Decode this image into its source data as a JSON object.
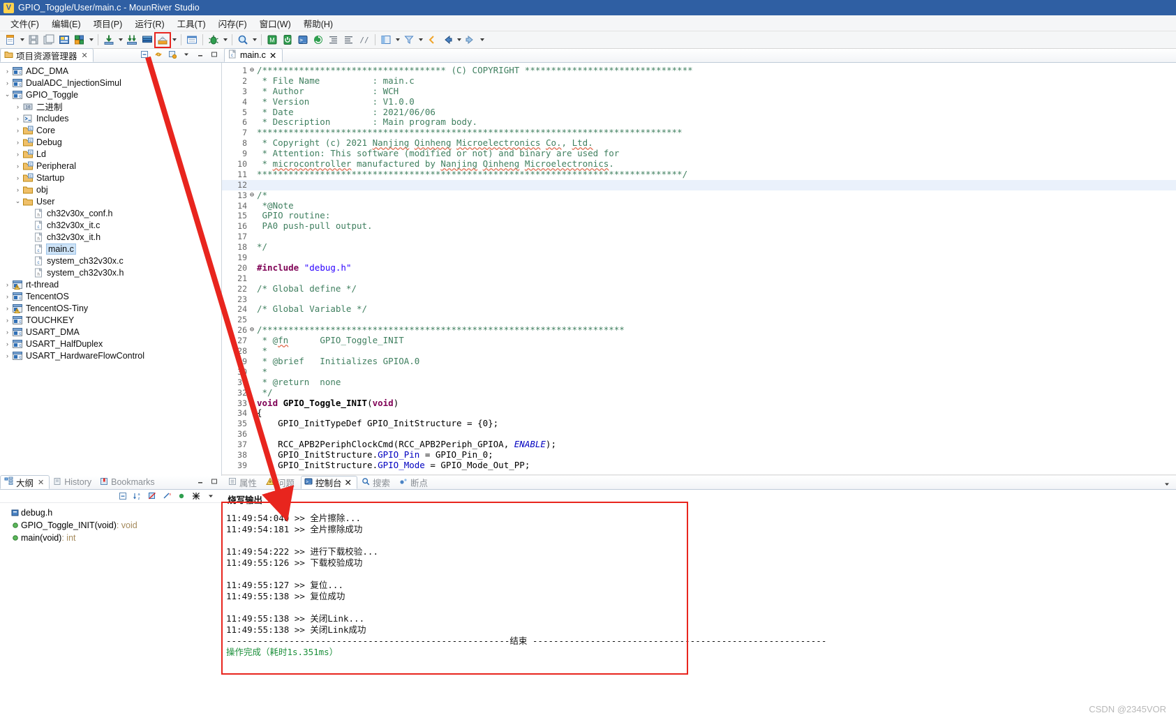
{
  "window": {
    "title": "GPIO_Toggle/User/main.c - MounRiver Studio",
    "app_icon": "mounriver-logo-icon"
  },
  "menubar": {
    "items": [
      {
        "label": "文件(F)",
        "name": "menu-file"
      },
      {
        "label": "编辑(E)",
        "name": "menu-edit"
      },
      {
        "label": "项目(P)",
        "name": "menu-project"
      },
      {
        "label": "运行(R)",
        "name": "menu-run"
      },
      {
        "label": "工具(T)",
        "name": "menu-tools"
      },
      {
        "label": "闪存(F)",
        "name": "menu-flash"
      },
      {
        "label": "窗口(W)",
        "name": "menu-window"
      },
      {
        "label": "帮助(H)",
        "name": "menu-help"
      }
    ]
  },
  "toolbar": {
    "highlighted_button": "download-flash-button",
    "buttons": [
      "new-file-icon",
      "save-icon",
      "save-all-icon",
      "build-project-icon",
      "build-config-icon",
      "download-icon",
      "download-all-icon",
      "library-icon",
      "download-flash-icon",
      "terminal-icon",
      "debug-icon",
      "search-icon",
      "excel-icon",
      "power-icon",
      "console-icon",
      "refresh-icon",
      "indent-left-icon",
      "indent-right-icon",
      "comment-icon",
      "perspective-icon",
      "filter-icon",
      "back-small-icon",
      "back-icon",
      "forward-icon"
    ]
  },
  "project_explorer": {
    "tab_label": "项目资源管理器",
    "tab_close": "✕",
    "tools": [
      "collapse-all-icon",
      "link-with-editor-icon",
      "view-menu-icon",
      "minimize-icon",
      "maximize-icon"
    ],
    "tree": [
      {
        "label": "ADC_DMA",
        "depth": 0,
        "arrow": "›",
        "icon": "c-project-icon",
        "selected": false
      },
      {
        "label": "DualADC_InjectionSimul",
        "depth": 0,
        "arrow": "›",
        "icon": "c-project-icon",
        "selected": false
      },
      {
        "label": "GPIO_Toggle",
        "depth": 0,
        "arrow": "⌄",
        "icon": "c-project-icon",
        "selected": false
      },
      {
        "label": "二进制",
        "depth": 1,
        "arrow": "›",
        "icon": "binaries-icon",
        "selected": false
      },
      {
        "label": "Includes",
        "depth": 1,
        "arrow": "›",
        "icon": "includes-icon",
        "selected": false
      },
      {
        "label": "Core",
        "depth": 1,
        "arrow": "›",
        "icon": "source-folder-icon",
        "selected": false
      },
      {
        "label": "Debug",
        "depth": 1,
        "arrow": "›",
        "icon": "source-folder-icon",
        "selected": false
      },
      {
        "label": "Ld",
        "depth": 1,
        "arrow": "›",
        "icon": "source-folder-icon",
        "selected": false
      },
      {
        "label": "Peripheral",
        "depth": 1,
        "arrow": "›",
        "icon": "source-folder-icon",
        "selected": false
      },
      {
        "label": "Startup",
        "depth": 1,
        "arrow": "›",
        "icon": "source-folder-icon",
        "selected": false
      },
      {
        "label": "obj",
        "depth": 1,
        "arrow": "›",
        "icon": "folder-icon",
        "selected": false
      },
      {
        "label": "User",
        "depth": 1,
        "arrow": "⌄",
        "icon": "folder-icon",
        "selected": false
      },
      {
        "label": "ch32v30x_conf.h",
        "depth": 2,
        "arrow": "",
        "icon": "h-file-icon",
        "selected": false
      },
      {
        "label": "ch32v30x_it.c",
        "depth": 2,
        "arrow": "",
        "icon": "c-file-icon",
        "selected": false
      },
      {
        "label": "ch32v30x_it.h",
        "depth": 2,
        "arrow": "",
        "icon": "h-file-icon",
        "selected": false
      },
      {
        "label": "main.c",
        "depth": 2,
        "arrow": "",
        "icon": "c-file-icon",
        "selected": true
      },
      {
        "label": "system_ch32v30x.c",
        "depth": 2,
        "arrow": "",
        "icon": "c-file-icon",
        "selected": false
      },
      {
        "label": "system_ch32v30x.h",
        "depth": 2,
        "arrow": "",
        "icon": "h-file-icon",
        "selected": false
      },
      {
        "label": "rt-thread",
        "depth": 0,
        "arrow": "›",
        "icon": "c-project-warn-icon",
        "selected": false
      },
      {
        "label": "TencentOS",
        "depth": 0,
        "arrow": "›",
        "icon": "c-project-icon",
        "selected": false
      },
      {
        "label": "TencentOS-Tiny",
        "depth": 0,
        "arrow": "›",
        "icon": "c-project-warn-icon",
        "selected": false
      },
      {
        "label": "TOUCHKEY",
        "depth": 0,
        "arrow": "›",
        "icon": "c-project-icon",
        "selected": false
      },
      {
        "label": "USART_DMA",
        "depth": 0,
        "arrow": "›",
        "icon": "c-project-icon",
        "selected": false
      },
      {
        "label": "USART_HalfDuplex",
        "depth": 0,
        "arrow": "›",
        "icon": "c-project-icon",
        "selected": false
      },
      {
        "label": "USART_HardwareFlowControl",
        "depth": 0,
        "arrow": "›",
        "icon": "c-project-icon",
        "selected": false
      }
    ]
  },
  "outline": {
    "tabs": [
      {
        "label": "大纲",
        "active": true,
        "icon": "outline-icon",
        "close": "✕"
      },
      {
        "label": "History",
        "active": false,
        "icon": "history-icon"
      },
      {
        "label": "Bookmarks",
        "active": false,
        "icon": "bookmarks-icon"
      }
    ],
    "tools": [
      "collapse-all-icon",
      "sort-icon",
      "hide-fields-icon",
      "hide-static-icon",
      "hide-nonpublic-icon",
      "link-icon",
      "view-menu-icon"
    ],
    "items": [
      {
        "icon": "include-icon",
        "label": "debug.h",
        "ret": ""
      },
      {
        "icon": "method-icon",
        "label": "GPIO_Toggle_INIT(void)",
        "ret": " : void"
      },
      {
        "icon": "method-icon",
        "label": "main(void)",
        "ret": " : int"
      }
    ]
  },
  "editor": {
    "tab": {
      "label": "main.c",
      "icon": "c-file-icon",
      "close": "✕"
    },
    "highlight_line": 12,
    "lines": [
      {
        "n": 1,
        "fold": "⊖",
        "html": "<span class=\"cm\">/*********************************** (C) COPYRIGHT ********************************</span>"
      },
      {
        "n": 2,
        "fold": "",
        "html": "<span class=\"cm\"> * File Name          : main.c</span>"
      },
      {
        "n": 3,
        "fold": "",
        "html": "<span class=\"cm\"> * Author             : WCH</span>"
      },
      {
        "n": 4,
        "fold": "",
        "html": "<span class=\"cm\"> * Version            : V1.0.0</span>"
      },
      {
        "n": 5,
        "fold": "",
        "html": "<span class=\"cm\"> * Date               : 2021/06/06</span>"
      },
      {
        "n": 6,
        "fold": "",
        "html": "<span class=\"cm\"> * Description        : Main program body.</span>"
      },
      {
        "n": 7,
        "fold": "",
        "html": "<span class=\"cm\">*********************************************************************************</span>"
      },
      {
        "n": 8,
        "fold": "",
        "html": "<span class=\"cm\"> * Copyright (c) 2021 <span class=\"sq\">Nanjing</span> <span class=\"sq\">Qinheng</span> <span class=\"sq\">Microelectronics</span> <span class=\"sq\">Co.</span>, <span class=\"sq\">Ltd.</span></span>"
      },
      {
        "n": 9,
        "fold": "",
        "html": "<span class=\"cm\"> * Attention: This software (modified or not) and binary are used for</span>"
      },
      {
        "n": 10,
        "fold": "",
        "html": "<span class=\"cm\"> * <span class=\"sq\">microcontroller</span> manufactured by <span class=\"sq\">Nanjing</span> <span class=\"sq\">Qinheng</span> <span class=\"sq\">Microelectronics</span>.</span>"
      },
      {
        "n": 11,
        "fold": "",
        "html": "<span class=\"cm\">*********************************************************************************/</span>"
      },
      {
        "n": 12,
        "fold": "",
        "html": ""
      },
      {
        "n": 13,
        "fold": "⊖",
        "html": "<span class=\"cm\">/*</span>"
      },
      {
        "n": 14,
        "fold": "",
        "html": "<span class=\"cm\"> *@Note</span>"
      },
      {
        "n": 15,
        "fold": "",
        "html": "<span class=\"cm\"> GPIO routine:</span>"
      },
      {
        "n": 16,
        "fold": "",
        "html": "<span class=\"cm\"> PA0 push-pull output.</span>"
      },
      {
        "n": 17,
        "fold": "",
        "html": "<span class=\"cm\"></span>"
      },
      {
        "n": 18,
        "fold": "",
        "html": "<span class=\"cm\">*/</span>"
      },
      {
        "n": 19,
        "fold": "",
        "html": ""
      },
      {
        "n": 20,
        "fold": "",
        "html": "<span class=\"pp\">#include</span> <span class=\"str\">\"debug.h\"</span>"
      },
      {
        "n": 21,
        "fold": "",
        "html": ""
      },
      {
        "n": 22,
        "fold": "",
        "html": "<span class=\"cm\">/* Global define */</span>"
      },
      {
        "n": 23,
        "fold": "",
        "html": ""
      },
      {
        "n": 24,
        "fold": "",
        "html": "<span class=\"cm\">/* Global Variable */</span>"
      },
      {
        "n": 25,
        "fold": "",
        "html": ""
      },
      {
        "n": 26,
        "fold": "⊖",
        "html": "<span class=\"cm\">/*********************************************************************</span>"
      },
      {
        "n": 27,
        "fold": "",
        "html": "<span class=\"cm\"> * @<span class=\"sq\">fn</span>      GPIO_Toggle_INIT</span>"
      },
      {
        "n": 28,
        "fold": "",
        "html": "<span class=\"cm\"> *</span>"
      },
      {
        "n": 29,
        "fold": "",
        "html": "<span class=\"cm\"> * @brief   Initializes GPIOA.0</span>"
      },
      {
        "n": 30,
        "fold": "",
        "html": "<span class=\"cm\"> *</span>"
      },
      {
        "n": 31,
        "fold": "",
        "html": "<span class=\"cm\"> * @return  none</span>"
      },
      {
        "n": 32,
        "fold": "",
        "html": "<span class=\"cm\"> */</span>"
      },
      {
        "n": 33,
        "fold": "⊖",
        "html": "<span class=\"kw\">void</span> <span class=\"fn\">GPIO_Toggle_INIT</span>(<span class=\"kw\">void</span>)"
      },
      {
        "n": 34,
        "fold": "",
        "html": "{"
      },
      {
        "n": 35,
        "fold": "",
        "html": "    GPIO_InitTypeDef GPIO_InitStructure = {0};"
      },
      {
        "n": 36,
        "fold": "",
        "html": ""
      },
      {
        "n": 37,
        "fold": "",
        "html": "    RCC_APB2PeriphClockCmd(RCC_APB2Periph_GPIOA, <span class=\"en\">ENABLE</span>);"
      },
      {
        "n": 38,
        "fold": "",
        "html": "    GPIO_InitStructure.<span class=\"fld\">GPIO_Pin</span> = GPIO_Pin_0;"
      },
      {
        "n": 39,
        "fold": "",
        "html": "    GPIO_InitStructure.<span class=\"fld\">GPIO_Mode</span> = GPIO_Mode_Out_PP;"
      }
    ]
  },
  "console": {
    "tabs": [
      {
        "label": "属性",
        "active": false,
        "icon": "properties-icon"
      },
      {
        "label": "问题",
        "active": false,
        "icon": "problems-icon"
      },
      {
        "label": "控制台",
        "active": true,
        "icon": "console-icon",
        "close": "✕"
      },
      {
        "label": "搜索",
        "active": false,
        "icon": "search-icon"
      },
      {
        "label": "断点",
        "active": false,
        "icon": "breakpoints-icon"
      }
    ],
    "header": "烧写输出",
    "output": [
      {
        "text": "11:49:54:040 >> 全片擦除...",
        "style": "normal"
      },
      {
        "text": "11:49:54:181 >> 全片擦除成功",
        "style": "normal"
      },
      {
        "text": "",
        "style": "normal"
      },
      {
        "text": "11:49:54:222 >> 进行下载校验...",
        "style": "normal"
      },
      {
        "text": "11:49:55:126 >> 下载校验成功",
        "style": "normal"
      },
      {
        "text": "",
        "style": "normal"
      },
      {
        "text": "11:49:55:127 >> 复位...",
        "style": "normal"
      },
      {
        "text": "11:49:55:138 >> 复位成功",
        "style": "normal"
      },
      {
        "text": "",
        "style": "normal"
      },
      {
        "text": "11:49:55:138 >> 关闭Link...",
        "style": "normal"
      },
      {
        "text": "11:49:55:138 >> 关闭Link成功",
        "style": "normal"
      },
      {
        "text": "------------------------------------------------------结束 --------------------------------------------------------",
        "style": "normal"
      },
      {
        "text": "操作完成（耗时1s.351ms）",
        "style": "ok"
      }
    ],
    "highlight_color": "#e8251e",
    "success_color": "#1b8f3a"
  },
  "annotation": {
    "arrow_color": "#e8251e",
    "description": "red-arrow-from-toolbar-to-console"
  },
  "watermark": "CSDN @2345VOR"
}
